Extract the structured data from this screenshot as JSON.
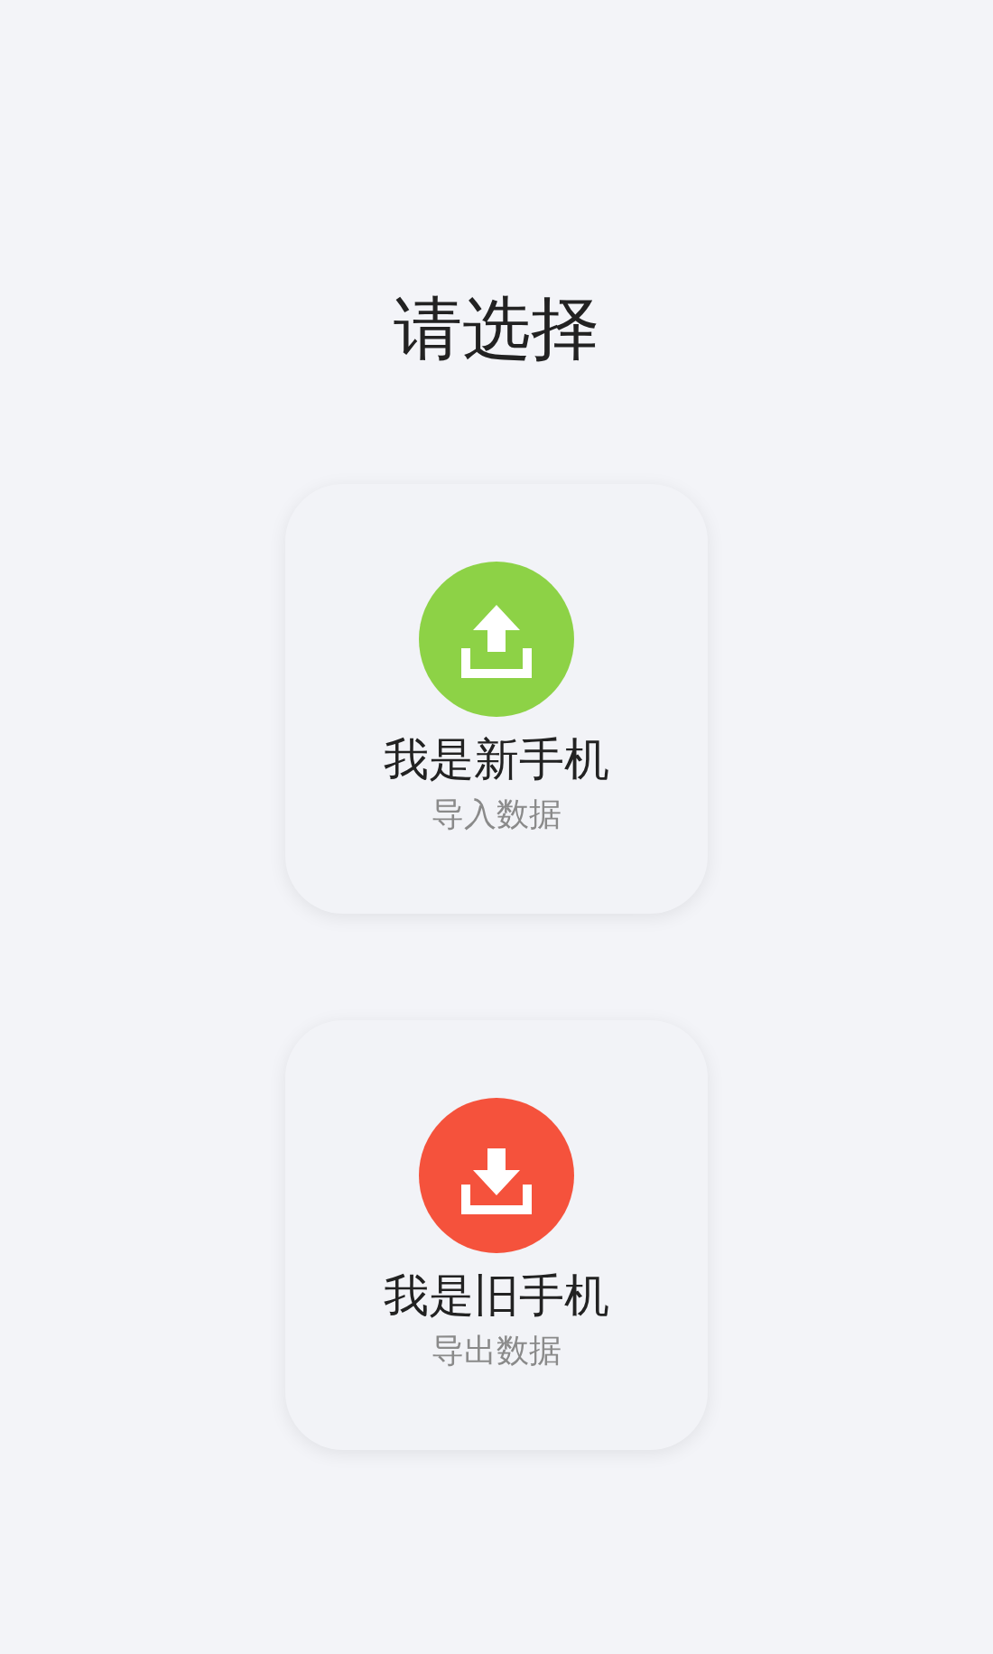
{
  "title": "请选择",
  "options": [
    {
      "kind": "upload",
      "color": "#8dd246",
      "label": "我是新手机",
      "caption": "导入数据"
    },
    {
      "kind": "download",
      "color": "#f5523c",
      "label": "我是旧手机",
      "caption": "导出数据"
    }
  ]
}
